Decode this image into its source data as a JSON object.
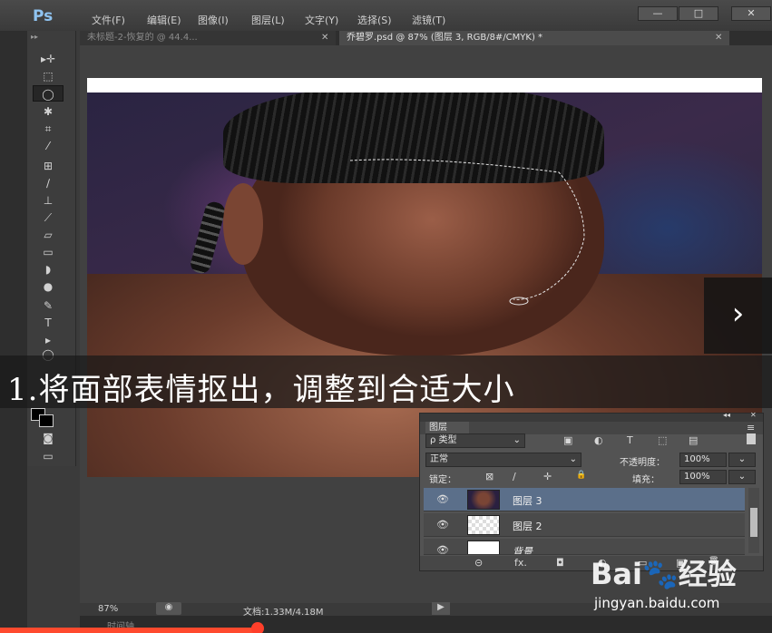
{
  "app": {
    "logo": "Ps"
  },
  "menu": [
    "文件(F)",
    "编辑(E)",
    "图像(I)",
    "图层(L)",
    "文字(Y)",
    "选择(S)",
    "滤镜(T)"
  ],
  "window_controls": {
    "minimize": "—",
    "restore": "□",
    "close": "✕"
  },
  "tabs": [
    {
      "label": "未标题-2-恢复的 @ 44.4...",
      "close": "✕",
      "active": false
    },
    {
      "label": "乔碧罗.psd @ 87% (图层 3, RGB/8#/CMYK) *",
      "close": "✕",
      "active": true
    }
  ],
  "toolbox": {
    "collapse_glyph": "▸▸",
    "tools": [
      {
        "name": "move",
        "glyph": "▸✛"
      },
      {
        "name": "marquee",
        "glyph": "⬚"
      },
      {
        "name": "lasso",
        "glyph": "◯",
        "active": true
      },
      {
        "name": "magic-wand",
        "glyph": "✱"
      },
      {
        "name": "crop",
        "glyph": "⌗"
      },
      {
        "name": "eyedropper",
        "glyph": "⁄"
      },
      {
        "name": "healing",
        "glyph": "⊞"
      },
      {
        "name": "brush",
        "glyph": "∕"
      },
      {
        "name": "stamp",
        "glyph": "⊥"
      },
      {
        "name": "history-brush",
        "glyph": "⟋"
      },
      {
        "name": "eraser",
        "glyph": "▱"
      },
      {
        "name": "gradient",
        "glyph": "▭"
      },
      {
        "name": "blur",
        "glyph": "◗"
      },
      {
        "name": "dodge",
        "glyph": "●"
      },
      {
        "name": "pen",
        "glyph": "✎"
      },
      {
        "name": "type",
        "glyph": "T"
      },
      {
        "name": "path-select",
        "glyph": "▸"
      },
      {
        "name": "shape",
        "glyph": "◯"
      }
    ],
    "quick_mask_glyph": "◙",
    "screen_mode_glyph": "▭"
  },
  "subtitle": "1.将面部表情抠出，调整到合适大小",
  "next_arrow": "›",
  "layers_panel": {
    "title": "图层",
    "header_glyphs": "◂◂",
    "menu_glyph": "≡",
    "filter_kind": "ρ 类型",
    "filter_icons": [
      "▣",
      "◐",
      "T",
      "⬚",
      "▤"
    ],
    "blend_mode": "正常",
    "opacity_label": "不透明度：",
    "opacity_value": "100%",
    "lock_label": "锁定：",
    "lock_icons": [
      "⊠",
      "∕",
      "✛",
      "🔒"
    ],
    "fill_label": "填充：",
    "fill_value": "100%",
    "layers": [
      {
        "name": "图层 3",
        "selected": true,
        "eye": "👁"
      },
      {
        "name": "图层 2",
        "selected": false,
        "eye": "👁"
      },
      {
        "name": "背景",
        "selected": false,
        "eye": "👁"
      }
    ],
    "bottom_icons": [
      "⊝",
      "fx.",
      "◘",
      "◐",
      "▭",
      "▣",
      "🗑"
    ]
  },
  "status": {
    "zoom": "87%",
    "doc": "文档:1.33M/4.18M",
    "arrow": "▶"
  },
  "timeline": {
    "label": "时间轴"
  },
  "watermark": {
    "logo": "Bai🐾经验",
    "url": "jingyan.baidu.com"
  },
  "colors": {
    "progress": "#ff4a2e",
    "selected_layer": "#5b6f8a",
    "ps_logo": "#8fc3f0"
  }
}
